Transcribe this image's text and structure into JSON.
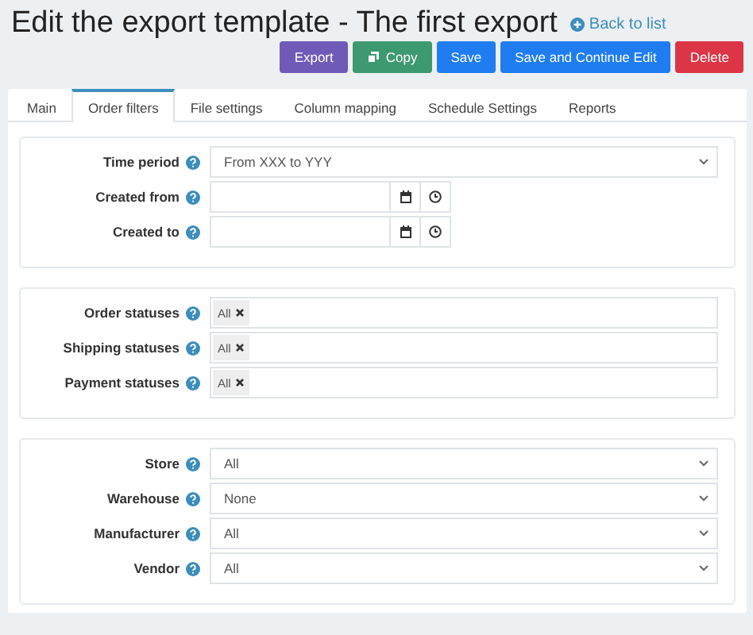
{
  "header": {
    "title": "Edit the export template - The first export",
    "back_link": "Back to list"
  },
  "buttons": [
    {
      "label": "Export",
      "kind": "export"
    },
    {
      "label": "Copy",
      "kind": "copy"
    },
    {
      "label": "Save",
      "kind": "save"
    },
    {
      "label": "Save and Continue Edit",
      "kind": "save"
    },
    {
      "label": "Delete",
      "kind": "delete"
    }
  ],
  "tabs": [
    {
      "label": "Main",
      "selected": false
    },
    {
      "label": "Order filters",
      "selected": true
    },
    {
      "label": "File settings",
      "selected": false
    },
    {
      "label": "Column mapping",
      "selected": false
    },
    {
      "label": "Schedule Settings",
      "selected": false
    },
    {
      "label": "Reports",
      "selected": false
    }
  ],
  "sections": [
    {
      "fields": [
        {
          "label": "Time period",
          "kind": "select",
          "value": "From XXX to YYY"
        },
        {
          "label": "Created from",
          "kind": "datetime"
        },
        {
          "label": "Created to",
          "kind": "datetime"
        }
      ]
    },
    {
      "fields": [
        {
          "label": "Order statuses",
          "kind": "tags",
          "tags": [
            "All"
          ]
        },
        {
          "label": "Shipping statuses",
          "kind": "tags",
          "tags": [
            "All"
          ]
        },
        {
          "label": "Payment statuses",
          "kind": "tags",
          "tags": [
            "All"
          ]
        }
      ]
    },
    {
      "fields": [
        {
          "label": "Store",
          "kind": "select",
          "value": "All"
        },
        {
          "label": "Warehouse",
          "kind": "select",
          "value": "None"
        },
        {
          "label": "Manufacturer",
          "kind": "select",
          "value": "All"
        },
        {
          "label": "Vendor",
          "kind": "select",
          "value": "All"
        }
      ]
    }
  ]
}
